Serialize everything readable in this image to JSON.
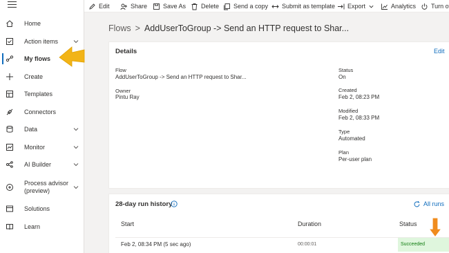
{
  "sidebar": {
    "items": [
      {
        "label": "Home",
        "icon": "home-icon"
      },
      {
        "label": "Action items",
        "icon": "checklist-icon",
        "chevron": true
      },
      {
        "label": "My flows",
        "icon": "flow-icon",
        "active": true
      },
      {
        "label": "Create",
        "icon": "plus-icon"
      },
      {
        "label": "Templates",
        "icon": "templates-icon"
      },
      {
        "label": "Connectors",
        "icon": "connector-icon"
      },
      {
        "label": "Data",
        "icon": "database-icon",
        "chevron": true
      },
      {
        "label": "Monitor",
        "icon": "monitor-icon",
        "chevron": true
      },
      {
        "label": "AI Builder",
        "icon": "ai-builder-icon",
        "chevron": true
      },
      {
        "label": "Process advisor (preview)",
        "icon": "process-advisor-icon",
        "chevron": true
      },
      {
        "label": "Solutions",
        "icon": "solutions-icon"
      },
      {
        "label": "Learn",
        "icon": "book-icon"
      }
    ]
  },
  "toolbar": {
    "edit": "Edit",
    "share": "Share",
    "save_as": "Save As",
    "delete": "Delete",
    "send_copy": "Send a copy",
    "submit_template": "Submit as template",
    "export": "Export",
    "analytics": "Analytics",
    "turn_off": "Turn of"
  },
  "breadcrumb": {
    "root": "Flows",
    "sep": ">",
    "current": "AddUserToGroup -> Send an HTTP request to Shar..."
  },
  "details": {
    "title": "Details",
    "edit": "Edit",
    "flow_label": "Flow",
    "flow_value": "AddUserToGroup -> Send an HTTP request to Shar...",
    "owner_label": "Owner",
    "owner_value": "Pintu Ray",
    "status_label": "Status",
    "status_value": "On",
    "created_label": "Created",
    "created_value": "Feb 2, 08:23 PM",
    "modified_label": "Modified",
    "modified_value": "Feb 2, 08:33 PM",
    "type_label": "Type",
    "type_value": "Automated",
    "plan_label": "Plan",
    "plan_value": "Per-user plan"
  },
  "run_history": {
    "title": "28-day run history",
    "all_runs": "All runs",
    "col_start": "Start",
    "col_duration": "Duration",
    "col_status": "Status",
    "rows": [
      {
        "start": "Feb 2, 08:34 PM (5 sec ago)",
        "duration": "00:00:01",
        "status": "Succeeded"
      }
    ]
  },
  "colors": {
    "accent": "#0f6cbd",
    "annotation_arrow": "#f2b417",
    "annotation_arrow_down": "#f08c1e",
    "success_bg": "#dff6dd",
    "success_text": "#107c10"
  }
}
